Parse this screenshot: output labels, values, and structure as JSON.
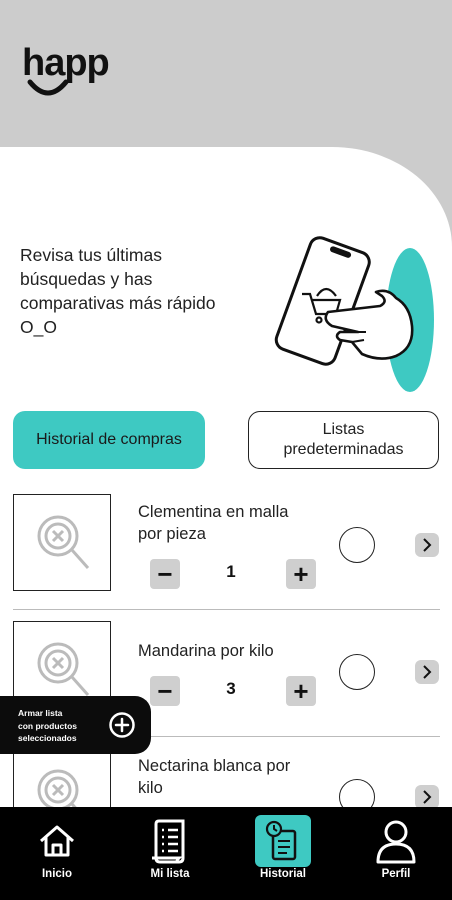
{
  "brand": {
    "logo_text": "happ",
    "accent_color": "#3ec9c2"
  },
  "intro": {
    "lines": [
      "Revisa tus últimas",
      "búsquedas y has",
      "comparativas más rápido",
      "O_O"
    ]
  },
  "tabs": {
    "active_label": "Historial de compras",
    "inactive_lines": [
      "Listas",
      "predeterminadas"
    ]
  },
  "products": [
    {
      "name_lines": [
        "Clementina en malla",
        "por pieza"
      ],
      "quantity": "1",
      "minus": "−",
      "plus": "+"
    },
    {
      "name_lines": [
        "Mandarina por kilo"
      ],
      "quantity": "3",
      "minus": "−",
      "plus": "+"
    },
    {
      "name_lines": [
        "Nectarina blanca por",
        "kilo"
      ]
    }
  ],
  "fab": {
    "lines": [
      "Armar lista",
      "con productos",
      "seleccionados"
    ],
    "icon": "plus-circle-icon"
  },
  "nav": {
    "items": [
      {
        "label": "Inicio",
        "icon": "home-icon"
      },
      {
        "label": "Mi lista",
        "icon": "list-icon"
      },
      {
        "label": "Historial",
        "icon": "history-icon",
        "active": true
      },
      {
        "label": "Perfil",
        "icon": "user-icon"
      }
    ]
  }
}
